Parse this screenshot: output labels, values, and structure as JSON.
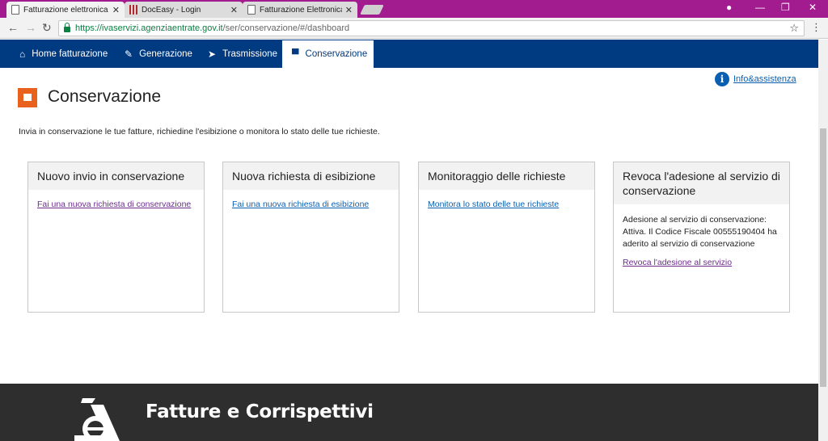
{
  "browser": {
    "tabs": [
      {
        "title": "Fatturazione elettronica",
        "close": "✕"
      },
      {
        "title": "DocEasy - Login",
        "close": "✕"
      },
      {
        "title": "Fatturazione Elettronica -",
        "close": "✕"
      }
    ],
    "url_host": "https://ivaservizi.agenziaentrate.gov.it",
    "url_path": "/ser/conservazione/#/dashboard"
  },
  "nav": {
    "items": [
      {
        "label": "Home fatturazione",
        "icon": "home-icon"
      },
      {
        "label": "Generazione",
        "icon": "pencil-icon"
      },
      {
        "label": "Trasmissione",
        "icon": "send-icon"
      },
      {
        "label": "Conservazione",
        "icon": "archive-icon"
      }
    ]
  },
  "help": {
    "label": "Info&assistenza"
  },
  "page": {
    "title": "Conservazione",
    "intro": "Invia in conservazione le tue fatture, richiedine l'esibizione o monitora lo stato delle tue richieste."
  },
  "cards": [
    {
      "title": "Nuovo invio in conservazione",
      "link": "Fai una nuova richiesta di conservazione"
    },
    {
      "title": "Nuova richiesta di esibizione",
      "link": "Fai una nuova richiesta di esibizione"
    },
    {
      "title": "Monitoraggio delle richieste",
      "link": "Monitora lo stato delle tue richieste"
    },
    {
      "title": "Revoca l'adesione al servizio di conservazione",
      "text": "Adesione al servizio di conservazione: Attiva. Il Codice Fiscale 00555190404 ha aderito al servizio di conservazione",
      "link": "Revoca l'adesione al servizio"
    }
  ],
  "footer": {
    "title": "Fatture e Corrispettivi"
  },
  "colors": {
    "tabbar": "#a21c8f",
    "nav": "#003a80",
    "accent": "#e8611d",
    "footer": "#2e2e2e"
  }
}
